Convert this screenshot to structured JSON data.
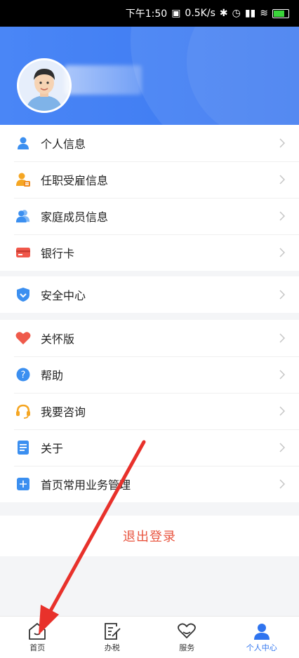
{
  "status_bar": {
    "time": "下午1:50",
    "net_speed": "0.5K/s",
    "battery": "60"
  },
  "menu_groups": [
    {
      "items": [
        {
          "label": "个人信息",
          "icon": "person-icon"
        },
        {
          "label": "任职受雇信息",
          "icon": "employment-icon"
        },
        {
          "label": "家庭成员信息",
          "icon": "family-icon"
        },
        {
          "label": "银行卡",
          "icon": "bank-card-icon"
        }
      ]
    },
    {
      "items": [
        {
          "label": "安全中心",
          "icon": "shield-icon"
        }
      ]
    },
    {
      "items": [
        {
          "label": "关怀版",
          "icon": "heart-icon"
        },
        {
          "label": "帮助",
          "icon": "help-icon"
        },
        {
          "label": "我要咨询",
          "icon": "headset-icon"
        },
        {
          "label": "关于",
          "icon": "document-icon"
        },
        {
          "label": "首页常用业务管理",
          "icon": "plus-square-icon"
        }
      ]
    }
  ],
  "logout_label": "退出登录",
  "tabs": [
    {
      "label": "首页",
      "icon": "home-icon",
      "active": false
    },
    {
      "label": "办税",
      "icon": "edit-document-icon",
      "active": false
    },
    {
      "label": "服务",
      "icon": "heart-hands-icon",
      "active": false
    },
    {
      "label": "个人中心",
      "icon": "user-icon",
      "active": true
    }
  ],
  "colors": {
    "header_blue": "#4a86f6",
    "logout_red": "#e8543f",
    "active_tab": "#2f74ef",
    "annotation_arrow": "#e8312b"
  }
}
